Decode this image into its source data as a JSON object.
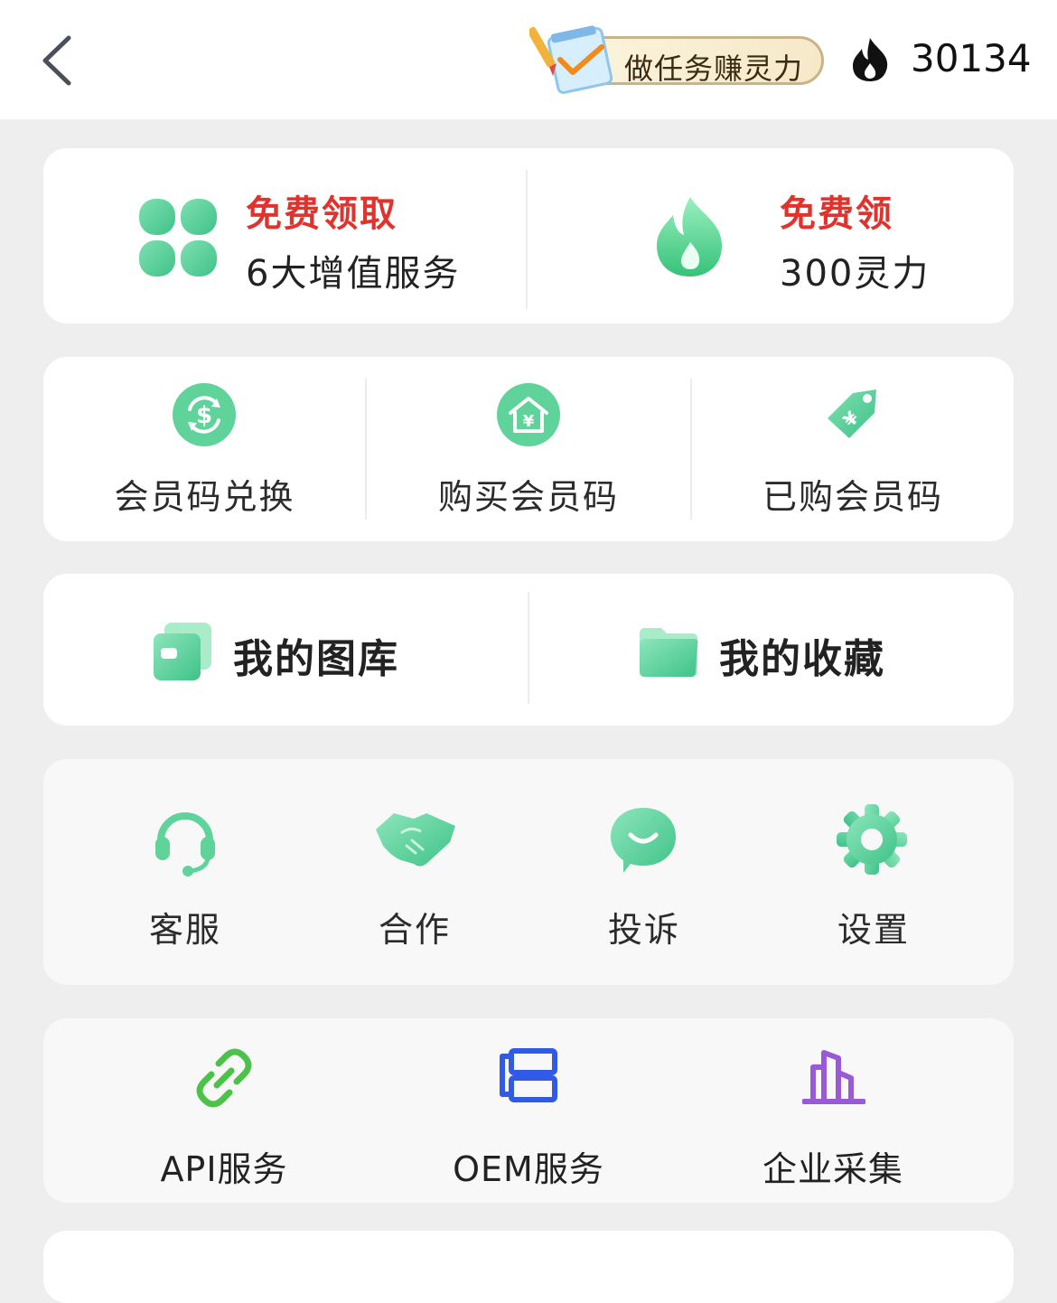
{
  "header": {
    "task_label": "做任务赚灵力",
    "points": "30134"
  },
  "promo": {
    "left": {
      "line1": "免费领取",
      "line2": "6大增值服务"
    },
    "right": {
      "line1": "免费领",
      "line2": "300灵力"
    }
  },
  "member": {
    "items": [
      {
        "label": "会员码兑换",
        "icon": "dollar-exchange-icon"
      },
      {
        "label": "购买会员码",
        "icon": "yen-house-icon"
      },
      {
        "label": "已购会员码",
        "icon": "yen-tag-icon"
      }
    ]
  },
  "library": {
    "gallery": "我的图库",
    "favorites": "我的收藏"
  },
  "support": {
    "items": [
      {
        "label": "客服",
        "icon": "headset-icon"
      },
      {
        "label": "合作",
        "icon": "handshake-icon"
      },
      {
        "label": "投诉",
        "icon": "chat-bubble-icon"
      },
      {
        "label": "设置",
        "icon": "gear-icon"
      }
    ]
  },
  "services": {
    "items": [
      {
        "label": "API服务",
        "icon": "link-icon",
        "color": "#4cc24a"
      },
      {
        "label": "OEM服务",
        "icon": "layers-icon",
        "color": "#2f5be6"
      },
      {
        "label": "企业采集",
        "icon": "buildings-icon",
        "color": "#9a5ad8"
      }
    ]
  },
  "colors": {
    "accent_green": "#5fd39a",
    "promo_red": "#e0332d",
    "background": "#eeeeee"
  }
}
